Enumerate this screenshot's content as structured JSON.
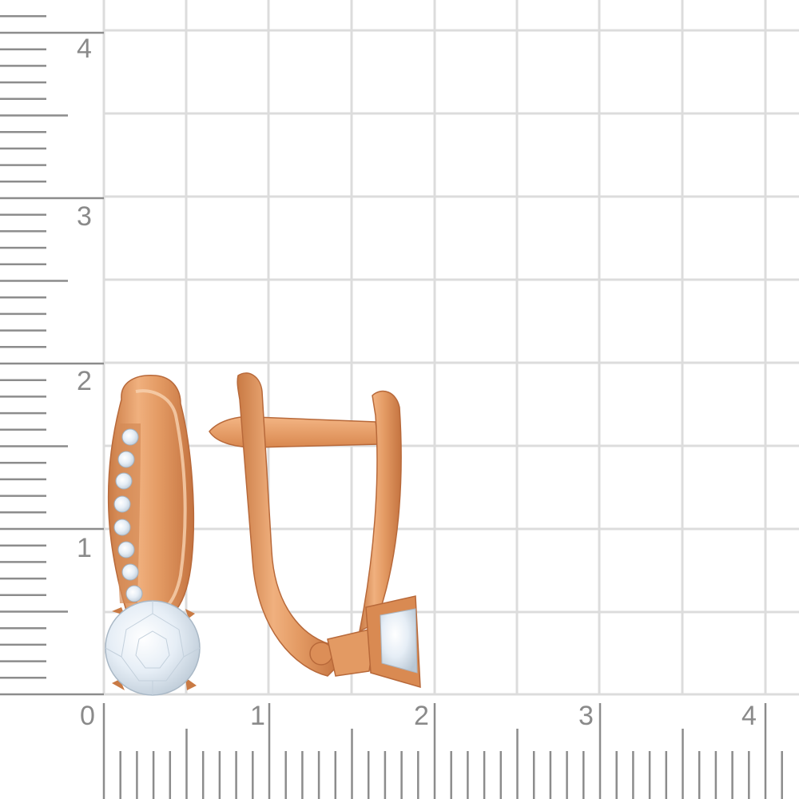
{
  "scale": {
    "unit_note": "",
    "x_labels": [
      "0",
      "1",
      "2",
      "3",
      "4"
    ],
    "y_labels": [
      "1",
      "2",
      "3",
      "4"
    ]
  },
  "colors": {
    "grid": "#dcdcdc",
    "ruler": "#8c8c8c",
    "gold": "#e39a63",
    "gold_dark": "#c97a44",
    "gold_light": "#f6c7a0",
    "stone": "#e9f0f7"
  },
  "product": {
    "item": "gold-earrings-with-stones",
    "views": [
      "front",
      "side"
    ]
  }
}
